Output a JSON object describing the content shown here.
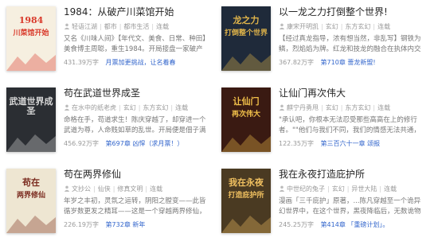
{
  "books": [
    {
      "title": "1984：从破产川菜馆开始",
      "author": "轻语江湖",
      "category": "都市",
      "subcategory": "都市生活",
      "status": "连载",
      "desc": "又名《川味人间》【年代文、美食、日常、种田】美食博主周聪，重生1984。开局接盘一家破产川菜馆。在这",
      "words": "431.39万字",
      "chapter_label": "月票加更挑战，让名着春",
      "cover": {
        "title_top": "1984",
        "title_main": "川菜馆开始",
        "bg": "#f6efe0",
        "accent": "#d93a2b"
      }
    },
    {
      "title": "以一龙之力打倒整个世界!",
      "author": "康宋开明凯",
      "category": "玄幻",
      "subcategory": "东方玄幻",
      "status": "连载",
      "desc": "【经过真龙指导，浓有想当然，非乱写】钢铁为鳞，烈焰焰为牌。红龙和技龙的融合在执体内交织融合，构筑出",
      "words": "367.82万字",
      "chapter_label": "第710章 蔷龙新盟!",
      "cover": {
        "title_top": "龙之力",
        "title_main": "打倒整个世界",
        "bg": "#1f2a3a",
        "accent": "#e0b44a"
      }
    },
    {
      "title": "苟在武道世界成圣",
      "author": "在水中的纸老虎",
      "category": "玄幻",
      "subcategory": "东方玄幻",
      "status": "连载",
      "desc": "命格在手，苟道求生！陈庆穿越了，却穿进一个武道为尊，人命贱如草的乱世。开局便是佃子满的贫苦渔家",
      "words": "456.92万字",
      "chapter_label": "第697章 凶悍（求月票！）",
      "cover": {
        "title_top": "武道世界成圣",
        "title_main": "",
        "bg": "#2b2e33",
        "accent": "#d8d8d8"
      }
    },
    {
      "title": "让仙门再次伟大",
      "author": "麒宁丹勇甩",
      "category": "玄幻",
      "subcategory": "东方玄幻",
      "status": "连载",
      "desc": "\"承认吧，你根本无法忍受那些高高在上的修行者。\"\"他们与我们不同，我们的情感无法共通，我们的逻辑",
      "words": "122.35万字",
      "chapter_label": "第三百六十一章 颂报",
      "cover": {
        "title_top": "让仙门",
        "title_main": "再次伟大",
        "bg": "#3a1a12",
        "accent": "#f2c14a"
      }
    },
    {
      "title": "苟在两界修仙",
      "author": "文抄公",
      "category": "仙侠",
      "subcategory": "修真文明",
      "status": "连载",
      "desc": "年岁之丰初，灵氛之运转，阴阳之膛变——此皆循岁数更发之精耳——这是一个穿越两界修仙，携束成为",
      "words": "226.19万字",
      "chapter_label": "第732章 新年",
      "cover": {
        "title_top": "苟在",
        "title_main": "两界修仙",
        "bg": "#eee6d2",
        "accent": "#7a2a1e"
      }
    },
    {
      "title": "我在永夜打造庇护所",
      "author": "中世纪的兔子",
      "category": "玄幻",
      "subcategory": "异世大陆",
      "status": "连载",
      "desc": "漫画「三千庇护」原著，...陈凡穿越至一个诡异幻世界中，在这个世界，黑夜降临后，无数诡物肆虐人间。",
      "words": "245.25万字",
      "chapter_label": "第414章 「重磅计划」。",
      "cover": {
        "title_top": "我在永夜",
        "title_main": "打造庇护所",
        "bg": "#4a3a22",
        "accent": "#f0c060"
      }
    }
  ]
}
